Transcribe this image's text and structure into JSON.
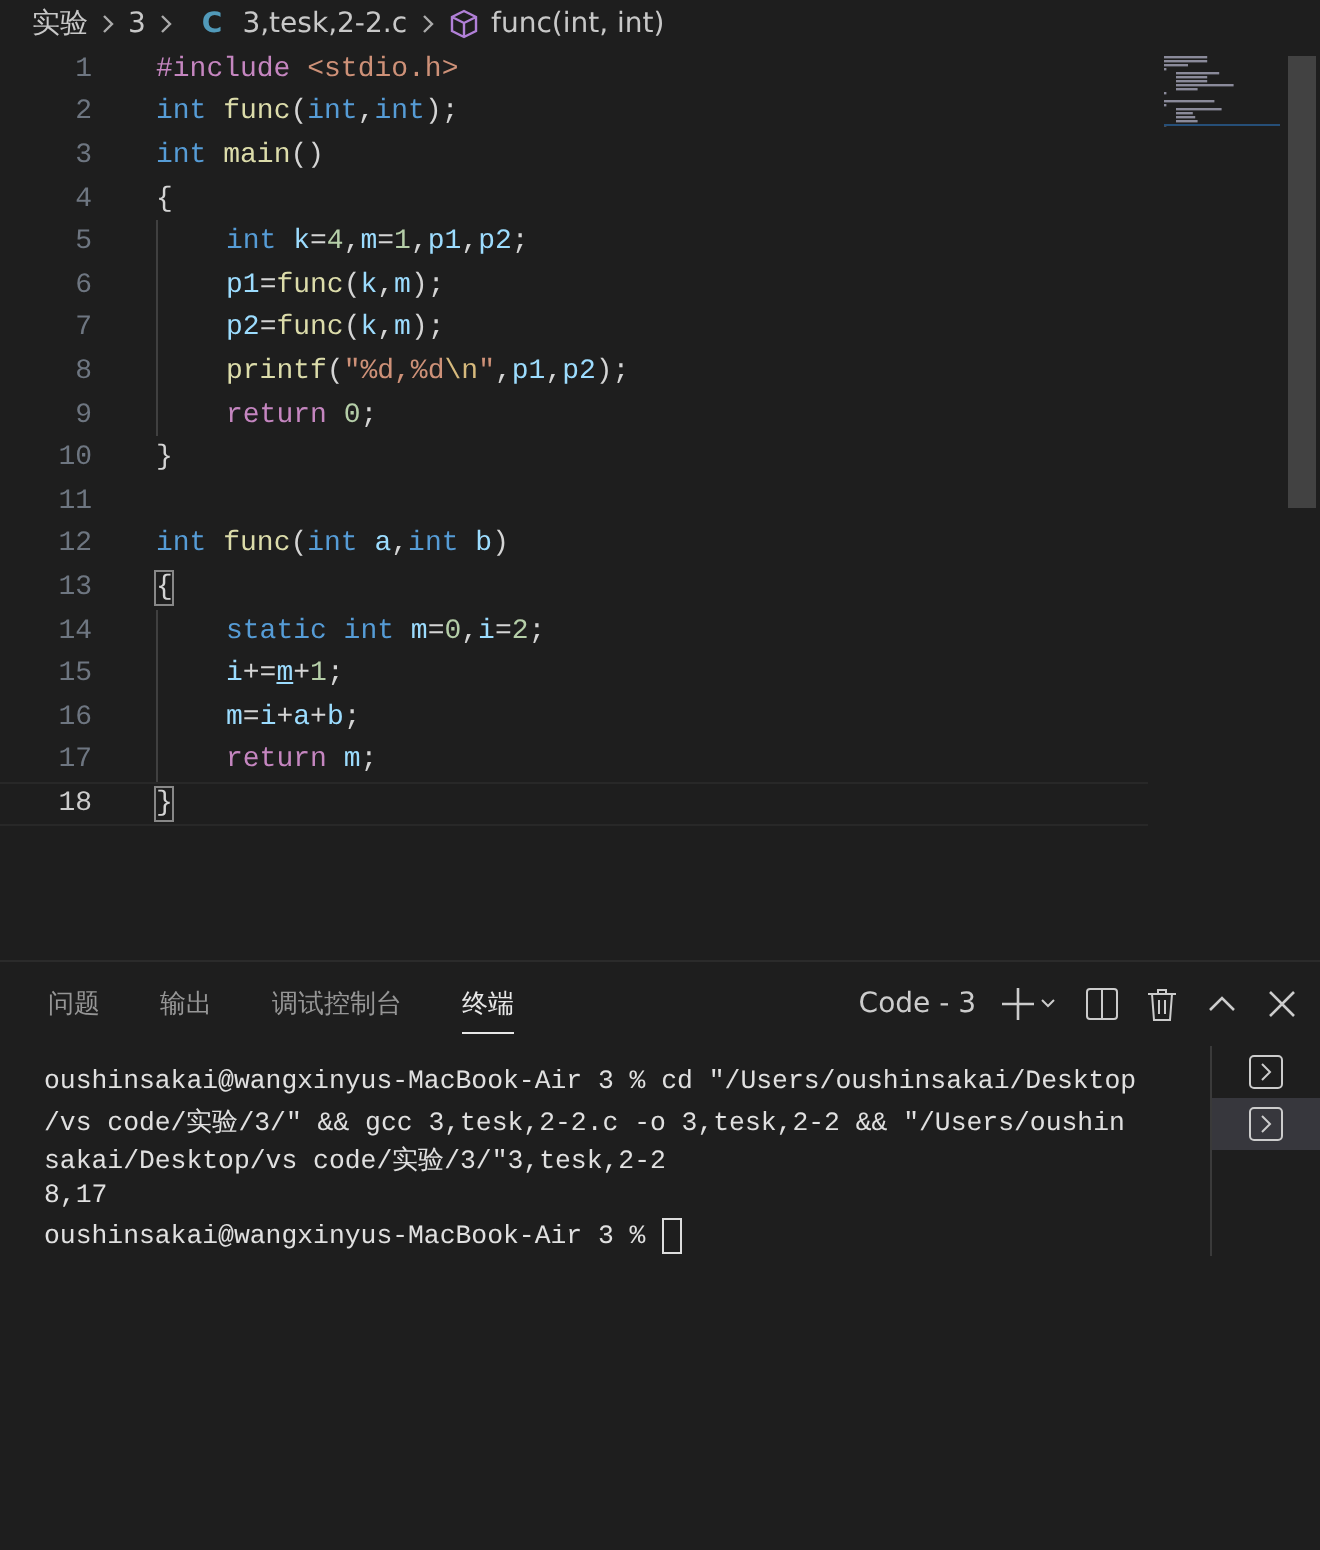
{
  "breadcrumb": [
    {
      "kind": "text",
      "label": "实验"
    },
    {
      "kind": "text",
      "label": "3"
    },
    {
      "kind": "c-file",
      "icon": "C",
      "label": "3,tesk,2-2.c"
    },
    {
      "kind": "symbol",
      "label": "func(int, int)"
    }
  ],
  "editor": {
    "lines": [
      {
        "number": "1",
        "indented": false,
        "current": false,
        "tokens": [
          {
            "kind": "preproc",
            "text": "#include "
          },
          {
            "kind": "string",
            "text": "<stdio.h>"
          }
        ]
      },
      {
        "number": "2",
        "indented": false,
        "current": false,
        "tokens": [
          {
            "kind": "keyword",
            "text": "int "
          },
          {
            "kind": "func",
            "text": "func"
          },
          {
            "kind": "punct",
            "text": "("
          },
          {
            "kind": "keyword",
            "text": "int"
          },
          {
            "kind": "punct",
            "text": ","
          },
          {
            "kind": "keyword",
            "text": "int"
          },
          {
            "kind": "punct",
            "text": ");"
          }
        ]
      },
      {
        "number": "3",
        "indented": false,
        "current": false,
        "tokens": [
          {
            "kind": "keyword",
            "text": "int "
          },
          {
            "kind": "func",
            "text": "main"
          },
          {
            "kind": "punct",
            "text": "()"
          }
        ]
      },
      {
        "number": "4",
        "indented": false,
        "current": false,
        "tokens": [
          {
            "kind": "punct",
            "text": "{"
          }
        ]
      },
      {
        "number": "5",
        "indented": true,
        "current": false,
        "tokens": [
          {
            "kind": "keyword",
            "text": "int "
          },
          {
            "kind": "var",
            "text": "k"
          },
          {
            "kind": "punct",
            "text": "="
          },
          {
            "kind": "num",
            "text": "4"
          },
          {
            "kind": "punct",
            "text": ","
          },
          {
            "kind": "var",
            "text": "m"
          },
          {
            "kind": "punct",
            "text": "="
          },
          {
            "kind": "num",
            "text": "1"
          },
          {
            "kind": "punct",
            "text": ","
          },
          {
            "kind": "var",
            "text": "p1"
          },
          {
            "kind": "punct",
            "text": ","
          },
          {
            "kind": "var",
            "text": "p2"
          },
          {
            "kind": "punct",
            "text": ";"
          }
        ]
      },
      {
        "number": "6",
        "indented": true,
        "current": false,
        "tokens": [
          {
            "kind": "var",
            "text": "p1"
          },
          {
            "kind": "punct",
            "text": "="
          },
          {
            "kind": "func",
            "text": "func"
          },
          {
            "kind": "punct",
            "text": "("
          },
          {
            "kind": "var",
            "text": "k"
          },
          {
            "kind": "punct",
            "text": ","
          },
          {
            "kind": "var",
            "text": "m"
          },
          {
            "kind": "punct",
            "text": ");"
          }
        ]
      },
      {
        "number": "7",
        "indented": true,
        "current": false,
        "tokens": [
          {
            "kind": "var",
            "text": "p2"
          },
          {
            "kind": "punct",
            "text": "="
          },
          {
            "kind": "func",
            "text": "func"
          },
          {
            "kind": "punct",
            "text": "("
          },
          {
            "kind": "var",
            "text": "k"
          },
          {
            "kind": "punct",
            "text": ","
          },
          {
            "kind": "var",
            "text": "m"
          },
          {
            "kind": "punct",
            "text": ");"
          }
        ]
      },
      {
        "number": "8",
        "indented": true,
        "current": false,
        "tokens": [
          {
            "kind": "func",
            "text": "printf"
          },
          {
            "kind": "punct",
            "text": "("
          },
          {
            "kind": "string",
            "text": "\"%d,%d"
          },
          {
            "kind": "escape",
            "text": "\\n"
          },
          {
            "kind": "string",
            "text": "\""
          },
          {
            "kind": "punct",
            "text": ","
          },
          {
            "kind": "var",
            "text": "p1"
          },
          {
            "kind": "punct",
            "text": ","
          },
          {
            "kind": "var",
            "text": "p2"
          },
          {
            "kind": "punct",
            "text": ");"
          }
        ]
      },
      {
        "number": "9",
        "indented": true,
        "current": false,
        "tokens": [
          {
            "kind": "control",
            "text": "return "
          },
          {
            "kind": "num",
            "text": "0"
          },
          {
            "kind": "punct",
            "text": ";"
          }
        ]
      },
      {
        "number": "10",
        "indented": false,
        "current": false,
        "tokens": [
          {
            "kind": "punct",
            "text": "}"
          }
        ]
      },
      {
        "number": "11",
        "indented": false,
        "current": false
      },
      {
        "number": "12",
        "indented": false,
        "current": false,
        "tokens": [
          {
            "kind": "keyword",
            "text": "int "
          },
          {
            "kind": "func",
            "text": "func"
          },
          {
            "kind": "punct",
            "text": "("
          },
          {
            "kind": "keyword",
            "text": "int "
          },
          {
            "kind": "var",
            "text": "a"
          },
          {
            "kind": "punct",
            "text": ","
          },
          {
            "kind": "keyword",
            "text": "int "
          },
          {
            "kind": "var",
            "text": "b"
          },
          {
            "kind": "punct",
            "text": ")"
          }
        ]
      },
      {
        "number": "13",
        "indented": false,
        "current": false,
        "tokens": [
          {
            "kind": "bracket-match",
            "text": "{"
          }
        ]
      },
      {
        "number": "14",
        "indented": true,
        "current": false,
        "tokens": [
          {
            "kind": "keyword",
            "text": "static int "
          },
          {
            "kind": "var",
            "text": "m"
          },
          {
            "kind": "punct",
            "text": "="
          },
          {
            "kind": "num",
            "text": "0"
          },
          {
            "kind": "punct",
            "text": ","
          },
          {
            "kind": "var",
            "text": "i"
          },
          {
            "kind": "punct",
            "text": "="
          },
          {
            "kind": "num",
            "text": "2"
          },
          {
            "kind": "punct",
            "text": ";"
          }
        ]
      },
      {
        "number": "15",
        "indented": true,
        "current": false,
        "tokens": [
          {
            "kind": "var",
            "text": "i"
          },
          {
            "kind": "punct",
            "text": "+="
          },
          {
            "kind": "ref",
            "text": "m"
          },
          {
            "kind": "punct",
            "text": "+"
          },
          {
            "kind": "num",
            "text": "1"
          },
          {
            "kind": "punct",
            "text": ";"
          }
        ]
      },
      {
        "number": "16",
        "indented": true,
        "current": false,
        "tokens": [
          {
            "kind": "var",
            "text": "m"
          },
          {
            "kind": "punct",
            "text": "="
          },
          {
            "kind": "var",
            "text": "i"
          },
          {
            "kind": "punct",
            "text": "+"
          },
          {
            "kind": "var",
            "text": "a"
          },
          {
            "kind": "punct",
            "text": "+"
          },
          {
            "kind": "var",
            "text": "b"
          },
          {
            "kind": "punct",
            "text": ";"
          }
        ]
      },
      {
        "number": "17",
        "indented": true,
        "current": false,
        "tokens": [
          {
            "kind": "control",
            "text": "return "
          },
          {
            "kind": "var",
            "text": "m"
          },
          {
            "kind": "punct",
            "text": ";"
          }
        ]
      },
      {
        "number": "18",
        "indented": false,
        "current": true,
        "tokens": [
          {
            "kind": "bracket-match",
            "text": "}"
          }
        ]
      }
    ]
  },
  "panel": {
    "tabs": [
      {
        "label": "问题",
        "selected": false
      },
      {
        "label": "输出",
        "selected": false
      },
      {
        "label": "调试控制台",
        "selected": false
      },
      {
        "label": "终端",
        "selected": true
      }
    ],
    "terminal_name": "Code - 3",
    "terminal_lines": [
      {
        "kind": "text",
        "text": "oushinsakai@wangxinyus-MacBook-Air 3 % cd \"/Users/oushinsakai/Desktop"
      },
      {
        "kind": "text",
        "text": "/vs code/实验/3/\" && gcc 3,tesk,2-2.c -o 3,tesk,2-2 && \"/Users/oushin"
      },
      {
        "kind": "text",
        "text": "sakai/Desktop/vs code/实验/3/\"3,tesk,2-2"
      },
      {
        "kind": "text",
        "text": "8,17"
      },
      {
        "kind": "prompt",
        "text": "oushinsakai@wangxinyus-MacBook-Air 3 %"
      }
    ],
    "terminals": [
      {
        "selected": false
      },
      {
        "selected": true
      }
    ]
  }
}
